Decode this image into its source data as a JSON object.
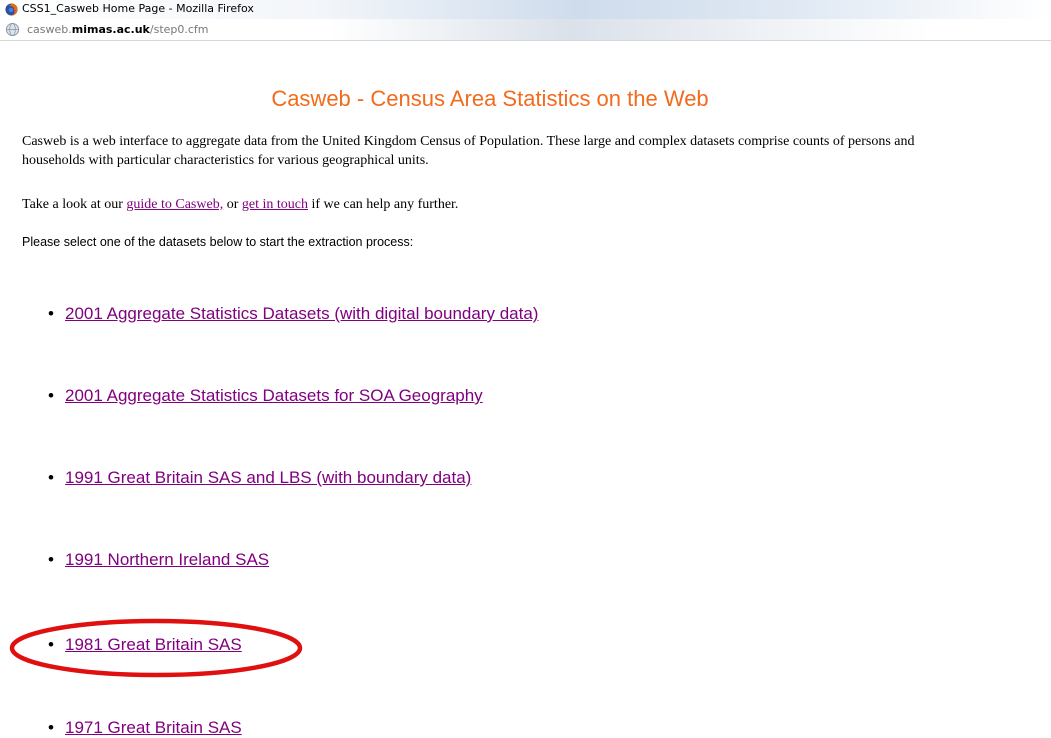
{
  "window": {
    "title": "CSS1_Casweb Home Page - Mozilla Firefox"
  },
  "address_bar": {
    "url_prefix": "casweb.",
    "url_domain": "mimas.ac.uk",
    "url_path": "/step0.cfm"
  },
  "page": {
    "heading": "Casweb - Census Area Statistics on the Web",
    "intro": "Casweb is a web interface to aggregate data from the United Kingdom Census of Population. These large and complex datasets comprise counts of persons and households with particular characteristics for various geographical units.",
    "help_prefix": "Take a look at our ",
    "guide_link": "guide to Casweb,",
    "help_mid": " or ",
    "contact_link": "get in touch",
    "help_suffix": " if we can help any further.",
    "instruction": "Please select one of the datasets below to start the extraction process:",
    "datasets": [
      {
        "label": "2001 Aggregate Statistics Datasets (with digital boundary data)"
      },
      {
        "label": "2001 Aggregate Statistics Datasets for SOA Geography"
      },
      {
        "label": "1991 Great Britain SAS and LBS (with boundary data)"
      },
      {
        "label": "1991 Northern Ireland SAS"
      },
      {
        "label": "1981 Great Britain SAS"
      },
      {
        "label": "1971 Great Britain SAS"
      }
    ]
  },
  "colors": {
    "heading": "#f26b1d",
    "link_visited": "#800080",
    "highlight_ring": "#e01010"
  },
  "icons": {
    "browser": "firefox-icon",
    "site": "globe-icon"
  }
}
